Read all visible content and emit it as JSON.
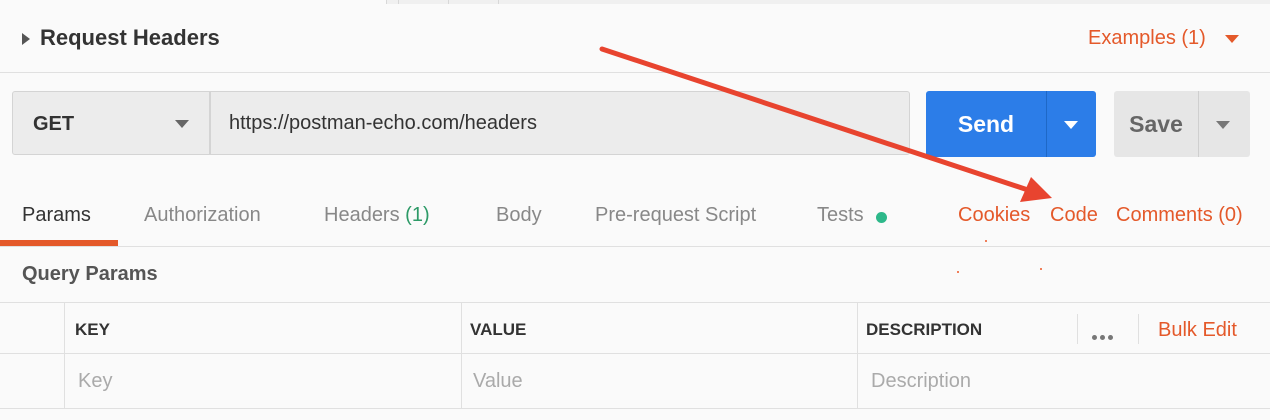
{
  "header": {
    "title": "Request Headers",
    "examples_label": "Examples (1)"
  },
  "request": {
    "method": "GET",
    "url": "https://postman-echo.com/headers",
    "send_label": "Send",
    "save_label": "Save"
  },
  "tabs": {
    "params": "Params",
    "authorization": "Authorization",
    "headers": "Headers",
    "headers_count": "(1)",
    "body": "Body",
    "prerequest": "Pre-request Script",
    "tests": "Tests",
    "cookies": "Cookies",
    "code": "Code",
    "comments": "Comments (0)"
  },
  "query_params": {
    "title": "Query Params",
    "columns": {
      "key": "KEY",
      "value": "VALUE",
      "description": "DESCRIPTION"
    },
    "bulk_edit": "Bulk Edit",
    "row": {
      "key_placeholder": "Key",
      "value_placeholder": "Value",
      "description_placeholder": "Description"
    }
  },
  "colors": {
    "accent": "#e4592a",
    "send": "#2c7de8",
    "tests_dot": "#2db88a",
    "headers_count": "#2d9a67",
    "annotation_arrow": "#e8442f"
  },
  "icons": {
    "collapse": "caret-right-icon",
    "dropdown": "caret-down-icon",
    "more": "more-dots-icon",
    "status": "status-dot-icon"
  }
}
